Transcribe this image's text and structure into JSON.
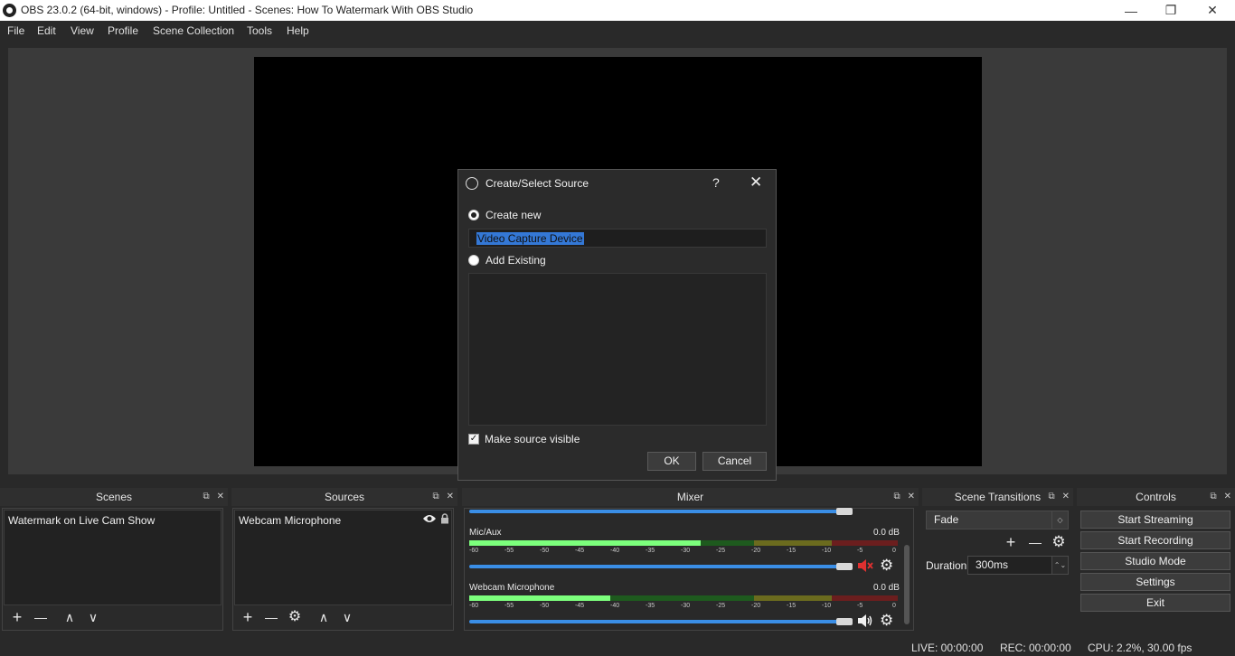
{
  "window": {
    "title": "OBS 23.0.2 (64-bit, windows) - Profile: Untitled - Scenes: How To Watermark With OBS Studio",
    "minimize": "—",
    "restore": "❐",
    "close": "✕"
  },
  "menu": [
    "File",
    "Edit",
    "View",
    "Profile",
    "Scene Collection",
    "Tools",
    "Help"
  ],
  "docks": {
    "float_icon": "⧉",
    "close_icon": "✕",
    "scenes": {
      "title": "Scenes",
      "items": [
        "Watermark on Live Cam Show"
      ]
    },
    "sources": {
      "title": "Sources",
      "items": [
        "Webcam Microphone"
      ]
    },
    "mixer": {
      "title": "Mixer",
      "channels": [
        {
          "name": "Mic/Aux",
          "db": "0.0 dB",
          "level": 0.54,
          "muted": true
        },
        {
          "name": "Webcam Microphone",
          "db": "0.0 dB",
          "level": 0.33,
          "muted": false
        }
      ],
      "ticks": [
        "-60",
        "-55",
        "-50",
        "-45",
        "-40",
        "-35",
        "-30",
        "-25",
        "-20",
        "-15",
        "-10",
        "-5",
        "0"
      ]
    },
    "transitions": {
      "title": "Scene Transitions",
      "selected": "Fade",
      "duration_label": "Duration",
      "duration": "300ms"
    },
    "controls": {
      "title": "Controls",
      "buttons": [
        "Start Streaming",
        "Start Recording",
        "Studio Mode",
        "Settings",
        "Exit"
      ]
    }
  },
  "toolbar_icons": {
    "add": "+",
    "remove": "—",
    "settings": "⚙",
    "up": "∧",
    "down": "∨"
  },
  "status": {
    "live": "LIVE: 00:00:00",
    "rec": "REC: 00:00:00",
    "cpu": "CPU: 2.2%, 30.00 fps"
  },
  "dialog": {
    "title": "Create/Select Source",
    "help": "?",
    "close": "✕",
    "create_new_label": "Create new",
    "name_value": "Video Capture Device",
    "add_existing_label": "Add Existing",
    "make_visible_label": "Make source visible",
    "make_visible_checked": true,
    "check_mark": "✓",
    "ok_label": "OK",
    "cancel_label": "Cancel"
  },
  "colors": {
    "volume_bar": "#3a8ee6",
    "selection": "#3478d6",
    "mute": "#e03030",
    "meter_level": "#7cff7c"
  }
}
